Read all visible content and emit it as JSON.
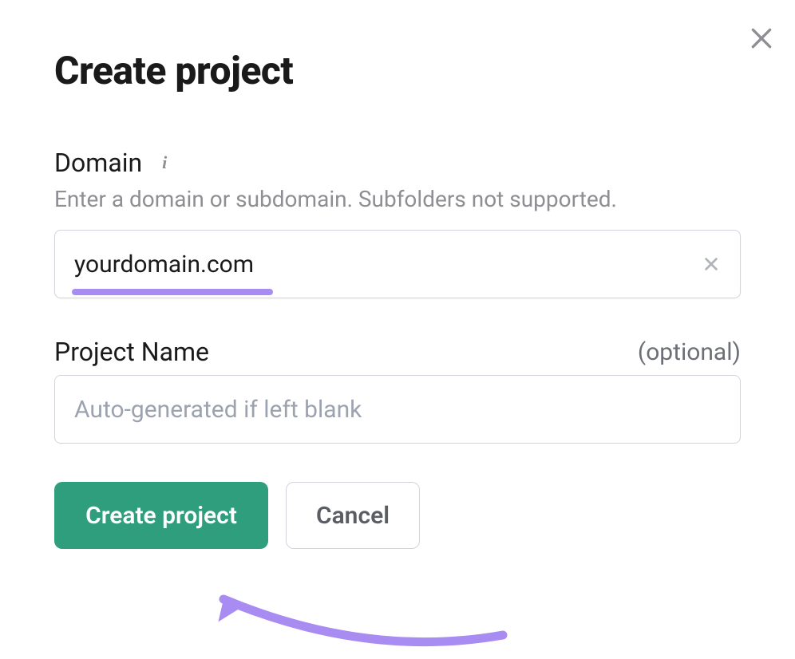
{
  "modal": {
    "title": "Create project",
    "domain": {
      "label": "Domain",
      "hint": "Enter a domain or subdomain. Subfolders not supported.",
      "value": "yourdomain.com"
    },
    "projectName": {
      "label": "Project Name",
      "optional": "(optional)",
      "placeholder": "Auto-generated if left blank",
      "value": ""
    },
    "buttons": {
      "create": "Create project",
      "cancel": "Cancel"
    }
  },
  "colors": {
    "primary": "#2f9e7c",
    "highlight": "#a98cf2",
    "textMuted": "#8e8e93"
  }
}
